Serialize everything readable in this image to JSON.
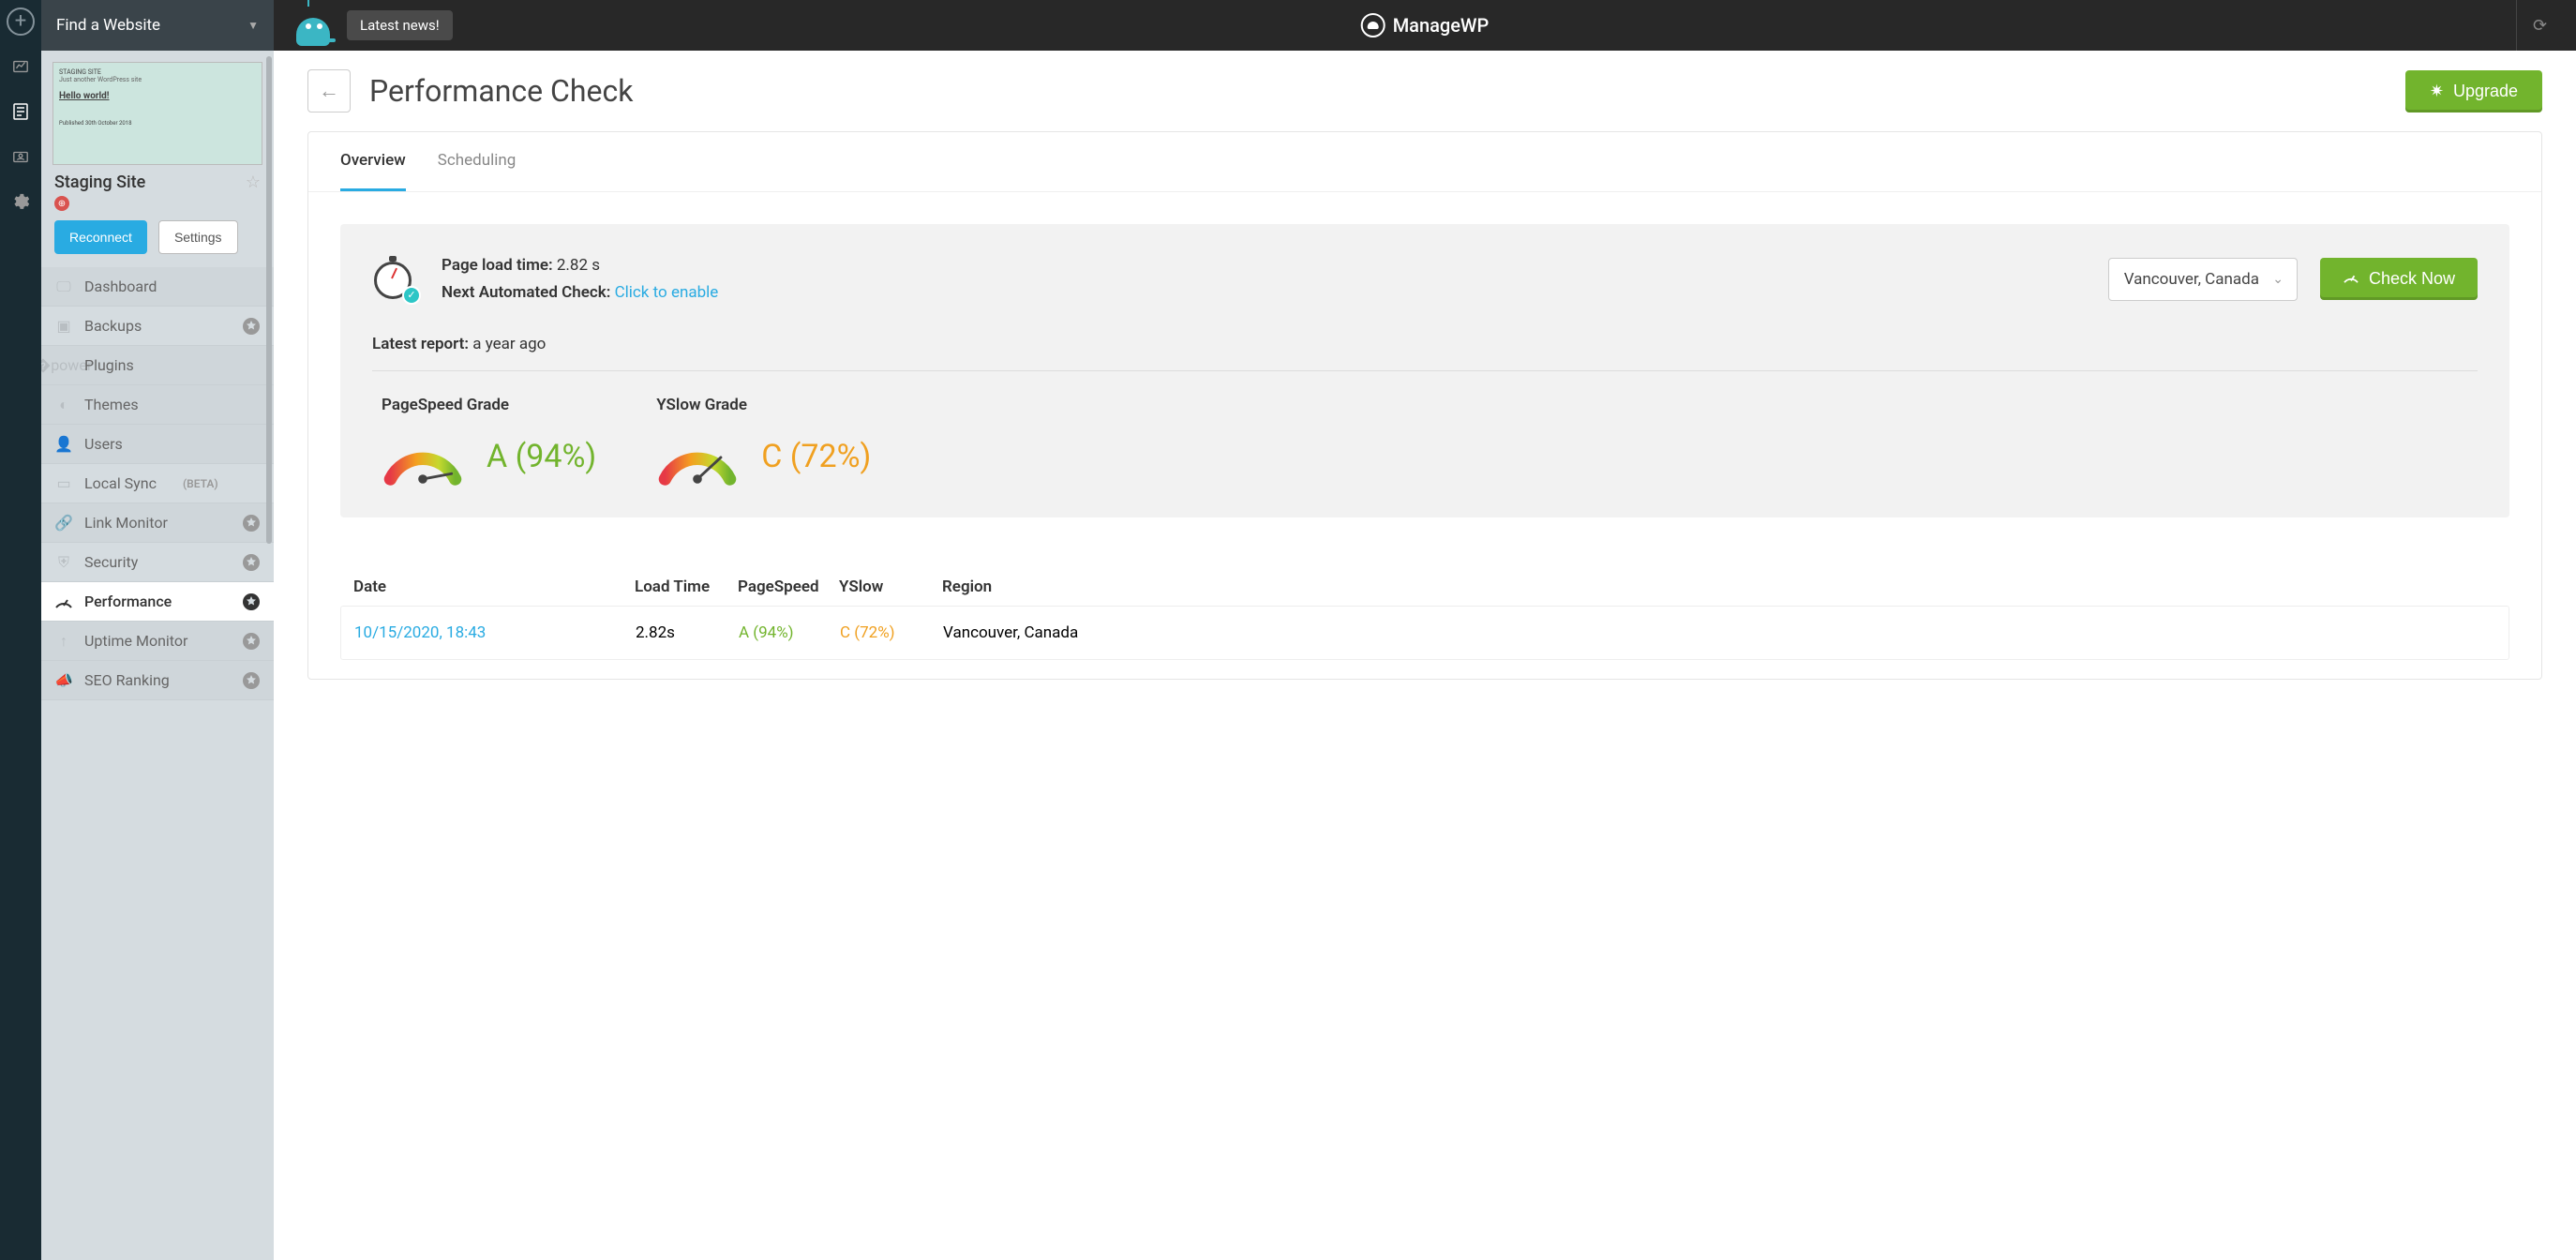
{
  "topbar": {
    "find_label": "Find a Website",
    "news": "Latest news!",
    "brand": "ManageWP"
  },
  "site": {
    "thumb_title": "STAGING SITE",
    "thumb_sub": "Just another WordPress site",
    "thumb_hello": "Hello world!",
    "thumb_meta": "Published 30th October 2018",
    "name": "Staging Site",
    "reconnect": "Reconnect",
    "settings": "Settings"
  },
  "nav": {
    "dashboard": "Dashboard",
    "backups": "Backups",
    "plugins": "Plugins",
    "themes": "Themes",
    "users": "Users",
    "local_sync": "Local Sync",
    "local_sync_beta": "(BETA)",
    "link_monitor": "Link Monitor",
    "security": "Security",
    "performance": "Performance",
    "uptime": "Uptime Monitor",
    "seo": "SEO Ranking"
  },
  "header": {
    "title": "Performance Check",
    "upgrade": "Upgrade"
  },
  "tabs": {
    "overview": "Overview",
    "scheduling": "Scheduling"
  },
  "summary": {
    "plt_label": "Page load time:",
    "plt_value": "2.82 s",
    "nac_label": "Next Automated Check:",
    "nac_link": "Click to enable",
    "region": "Vancouver, Canada",
    "check_now": "Check Now",
    "latest_label": "Latest report:",
    "latest_value": "a year ago",
    "ps_label": "PageSpeed Grade",
    "ps_value": "A (94%)",
    "ys_label": "YSlow Grade",
    "ys_value": "C (72%)"
  },
  "table": {
    "h_date": "Date",
    "h_load": "Load Time",
    "h_ps": "PageSpeed",
    "h_ys": "YSlow",
    "h_reg": "Region",
    "r_date": "10/15/2020, 18:43",
    "r_load": "2.82s",
    "r_ps": "A (94%)",
    "r_ys": "C (72%)",
    "r_reg": "Vancouver, Canada"
  }
}
